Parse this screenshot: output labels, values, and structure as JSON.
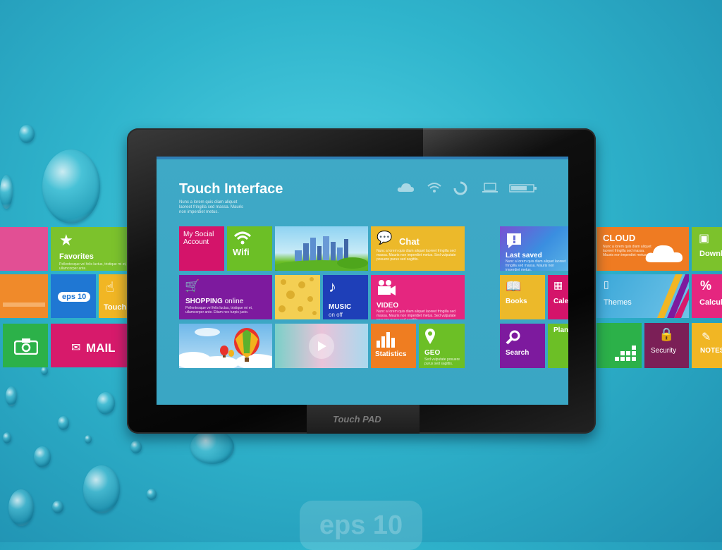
{
  "screen": {
    "title": "Touch Interface",
    "subtitle_lines": [
      "Nunc a lorem quis diam aliquet",
      "laoreet fringilla sed massa. Mauris",
      "non imperdiet metus."
    ]
  },
  "status_icons": [
    "cloud-icon",
    "wifi-icon",
    "loading-icon",
    "laptop-icon",
    "battery-icon"
  ],
  "tiles": {
    "my_social_account": "My Social Account",
    "wifi": "Wifi",
    "chat": "Chat",
    "chat_desc": "Nunc a lorem quis diam aliquet laoreet fringilla sed massa. Mauris non imperdiet metus. Sed vulputate posuere purus sed sagittis.",
    "shopping_bold": "SHOPPING",
    "shopping_rest": " online",
    "shopping_desc": "Pellentesque vel felis luctus, tristique mi et, ullamcorper ante. Etiam nec turpis justo.",
    "music": "MUSIC",
    "music_sub": "on off",
    "video": "VIDEO",
    "video_desc": "Nunc a lorem quis diam aliquet laoreet fringilla sed massa. Mauris non imperdiet metus. Sed vulputate posuere purus sed sagittis.",
    "statistics": "Statistics",
    "geo": "GEO",
    "geo_desc": "Sed vulputate posuere purus sed sagittis.",
    "last_saved": "Last saved",
    "last_saved_desc": "Nunc a lorem quis diam aliquet laoreet fringilla sed massa. Mauris non imperdiet metus.",
    "books": "Books",
    "calendar": "Cale",
    "search": "Search",
    "planner": "Plan"
  },
  "outer_tiles": {
    "favorites": "Favorites",
    "favorites_desc": "Pellentesque vel felis luctus, tristique mi et, ullamcorper ante.",
    "eps": "eps 10",
    "touch": "Touch",
    "mail": "MAIL",
    "cloud": "CLOUD",
    "cloud_desc": "Nunc a lorem quis diam aliquet laoreet fringilla sed massa. Mauris non imperdiet metus.",
    "download": "Downl",
    "themes": "Themes",
    "calculator": "Calcul",
    "security": "Security",
    "notes": "NOTES"
  },
  "device_label": "Touch PAD",
  "watermark": "eps 10",
  "colors": {
    "magenta": "#d4146a",
    "green": "#6cbf26",
    "orange": "#ef7d21",
    "purple": "#7d1a9e",
    "yellow": "#ecb92a",
    "blue": "#1e6fd0",
    "pink": "#e5267f"
  }
}
